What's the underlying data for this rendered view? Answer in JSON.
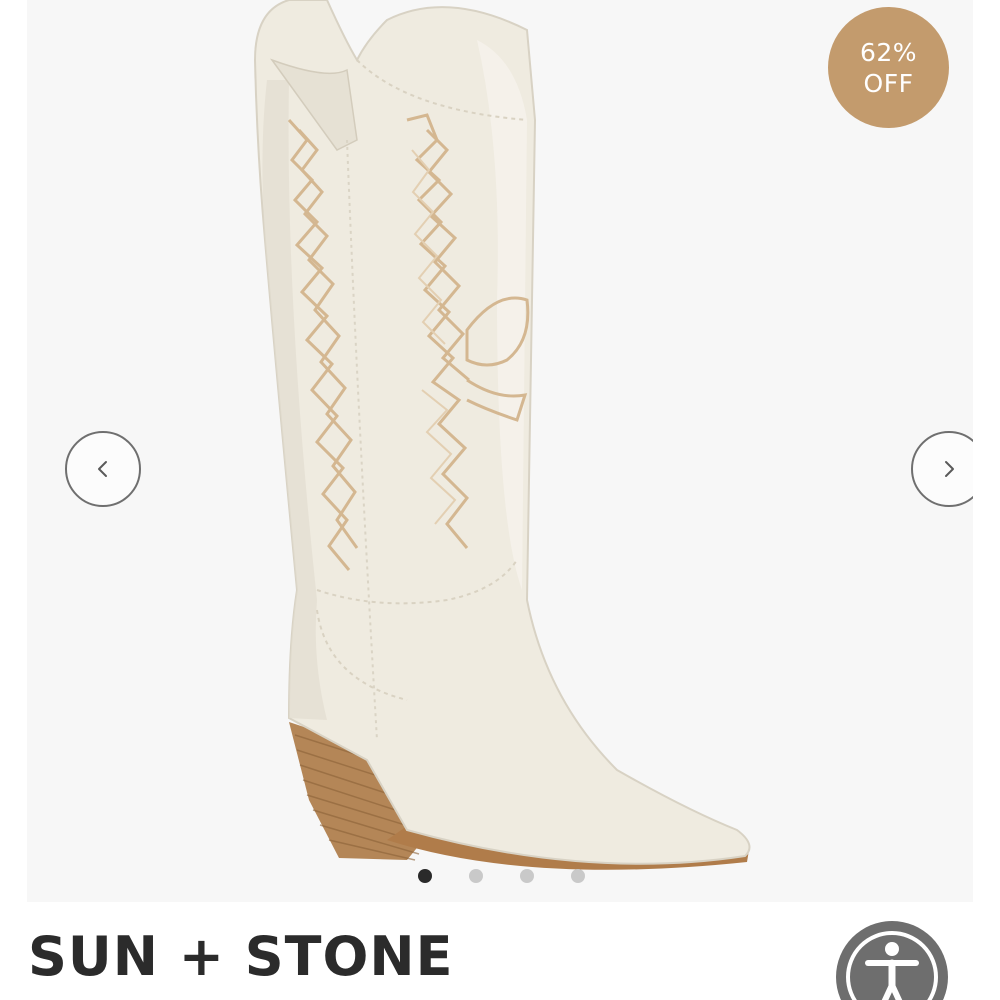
{
  "product": {
    "discount_badge": {
      "percent": "62%",
      "label": "OFF",
      "color": "#c39b6d"
    },
    "image": {
      "icon": "product-photo-western-boot"
    },
    "gallery": {
      "prev_icon": "chevron-left-icon",
      "next_icon": "chevron-right-icon",
      "slide_count": 4,
      "active_slide": 1
    },
    "brand": "SUN + STONE"
  },
  "accessibility": {
    "icon": "accessibility-person-icon",
    "color": "#6e6e6e"
  }
}
